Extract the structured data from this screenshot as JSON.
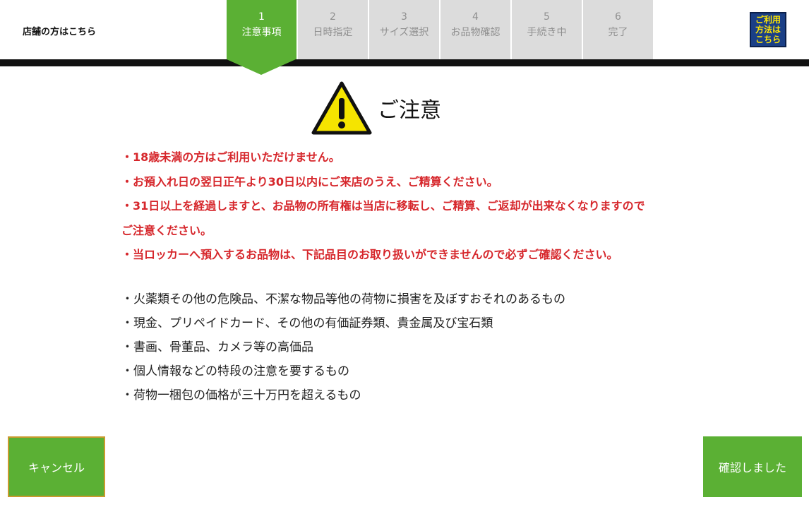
{
  "header": {
    "store_link": "店舗の方はこちら",
    "help_button": "ご利用\n方法は\nこちら",
    "steps": [
      {
        "num": "1",
        "label": "注意事項",
        "active": true
      },
      {
        "num": "2",
        "label": "日時指定",
        "active": false
      },
      {
        "num": "3",
        "label": "サイズ選択",
        "active": false
      },
      {
        "num": "4",
        "label": "お品物確認",
        "active": false
      },
      {
        "num": "5",
        "label": "手続き中",
        "active": false
      },
      {
        "num": "6",
        "label": "完了",
        "active": false
      }
    ]
  },
  "main": {
    "title": "ご注意",
    "icon": "warning-icon",
    "notices": [
      "・18歳未満の方はご利用いただけません。",
      "・お預入れ日の翌日正午より30日以内にご来店のうえ、ご精算ください。",
      "・31日以上を経過しますと、お品物の所有権は当店に移転し、ご精算、ご返却が出来なくなりますので",
      "ご注意ください。",
      "・当ロッカーへ預入するお品物は、下記品目のお取り扱いができませんので必ずご確認ください。"
    ],
    "prohibited_items": [
      "・火薬類その他の危険品、不潔な物品等他の荷物に損害を及ぼすおそれのあるもの",
      "・現金、プリペイドカード、その他の有価証券類、貴金属及び宝石類",
      "・書画、骨董品、カメラ等の高価品",
      "・個人情報などの特段の注意を要するもの",
      "・荷物一梱包の価格が三十万円を超えるもの"
    ]
  },
  "footer": {
    "cancel_label": "キャンセル",
    "confirm_label": "確認しました"
  },
  "colors": {
    "accent": "#5bb034",
    "warning_text": "#d6262b",
    "inactive_step": "#dcdcdc",
    "help_bg": "#1a3f86",
    "help_text": "#ffe600"
  }
}
